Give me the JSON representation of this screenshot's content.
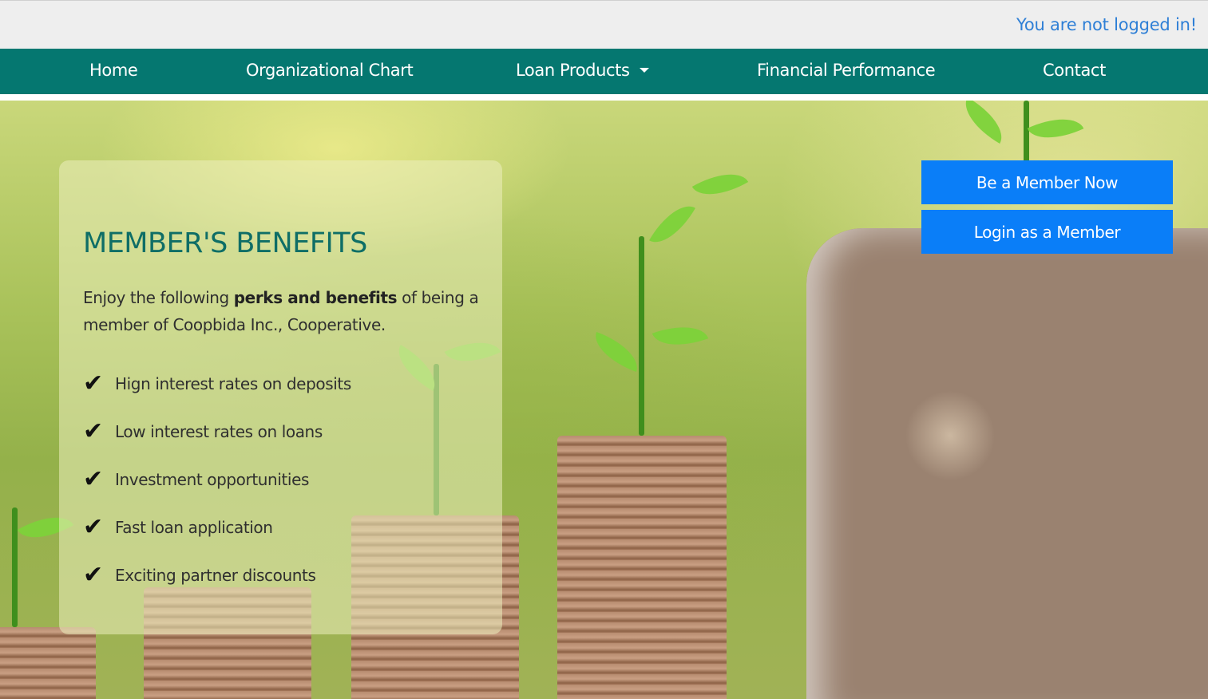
{
  "header": {
    "login_status": "You are not logged in!"
  },
  "nav": {
    "items": [
      {
        "label": "Home"
      },
      {
        "label": "Organizational Chart"
      },
      {
        "label": "Loan Products",
        "has_dropdown": true
      },
      {
        "label": "Financial Performance"
      },
      {
        "label": "Contact"
      }
    ]
  },
  "benefits": {
    "title": "MEMBER'S BENEFITS",
    "intro_before": "Enjoy the following ",
    "intro_bold": "perks and benefits",
    "intro_after": " of being a member of Coopbida Inc., Cooperative.",
    "check_glyph": "✔",
    "items": [
      "Hign interest rates on deposits",
      "Low interest rates on loans",
      "Investment opportunities",
      "Fast loan application",
      "Exciting partner discounts"
    ]
  },
  "actions": {
    "be_member": "Be a Member Now",
    "login_member": "Login as a Member"
  },
  "colors": {
    "nav_bg": "#057770",
    "title": "#0f6e66",
    "cta_bg": "#0a7ef8",
    "status_text": "#2e7fd6"
  }
}
